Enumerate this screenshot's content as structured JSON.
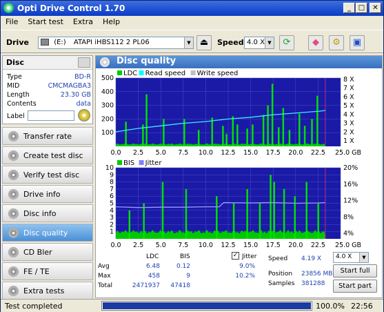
{
  "title": "Opti Drive Control 1.70",
  "menu": [
    "File",
    "Start test",
    "Extra",
    "Help"
  ],
  "toolbar": {
    "drive_label": "Drive",
    "drive_letter": "(E:)",
    "drive_name": "ATAPI  iHBS112   2 PL06",
    "speed_label": "Speed",
    "speed_value": "4.0 X"
  },
  "disc": {
    "header": "Disc",
    "rows": [
      {
        "k": "Type",
        "v": "BD-R"
      },
      {
        "k": "MID",
        "v": "CMCMAGBA3"
      },
      {
        "k": "Length",
        "v": "23.30 GB"
      },
      {
        "k": "Contents",
        "v": "data"
      }
    ],
    "label_key": "Label",
    "label_placeholder": ""
  },
  "nav": [
    "Transfer rate",
    "Create test disc",
    "Verify test disc",
    "Drive info",
    "Disc info",
    "Disc quality",
    "CD Bler",
    "FE / TE",
    "Extra tests"
  ],
  "nav_active": 5,
  "panel_title": "Disc quality",
  "chart_data": [
    {
      "type": "area",
      "legend": [
        "LDC",
        "Read speed",
        "Write speed"
      ],
      "legend_colors": [
        "#00cc00",
        "#00ffff",
        "#c0c0c0"
      ],
      "yticks_left": [
        "500",
        "400",
        "300",
        "200",
        "100"
      ],
      "yticks_right": [
        "8 X",
        "7 X",
        "6 X",
        "5 X",
        "4 X",
        "3 X",
        "2 X",
        "1 X"
      ],
      "xticks": [
        "0.0",
        "2.5",
        "5.0",
        "7.5",
        "10.0",
        "12.5",
        "15.0",
        "17.5",
        "20.0",
        "22.5",
        "25.0 GB"
      ],
      "ylim": [
        0,
        500
      ],
      "xlim": [
        0,
        25
      ],
      "read_speed": {
        "x": [
          0,
          2.5,
          5,
          7.5,
          10,
          12.5,
          15,
          17.5,
          20,
          22.5,
          23.3
        ],
        "y": [
          1.7,
          2.1,
          2.4,
          2.7,
          2.9,
          3.2,
          3.4,
          3.7,
          3.9,
          4.1,
          4.19
        ]
      },
      "spikes": {
        "x": [
          1.1,
          3.0,
          3.4,
          5.3,
          7.6,
          9.2,
          10.7,
          11.9,
          12.3,
          13.0,
          13.5,
          14.6,
          15.2,
          16.4,
          16.9,
          17.4,
          18.1,
          18.6,
          19.3,
          20.4,
          21.0,
          21.8,
          22.4
        ],
        "y": [
          180,
          160,
          380,
          200,
          200,
          120,
          210,
          150,
          90,
          220,
          160,
          130,
          160,
          230,
          300,
          458,
          140,
          280,
          120,
          240,
          150,
          200,
          370
        ]
      }
    },
    {
      "type": "area",
      "legend": [
        "BIS",
        "Jitter"
      ],
      "legend_colors": [
        "#00cc00",
        "#8080ff"
      ],
      "yticks_left": [
        "10",
        "9",
        "8",
        "7",
        "6",
        "5",
        "4",
        "3",
        "2",
        "1"
      ],
      "yticks_right": [
        "20%",
        "16%",
        "12%",
        "8%",
        "4%"
      ],
      "xticks": [
        "0.0",
        "2.5",
        "5.0",
        "7.5",
        "10.0",
        "12.5",
        "15.0",
        "17.5",
        "20.0",
        "22.5",
        "25.0 GB"
      ],
      "ylim": [
        0,
        10
      ],
      "xlim": [
        0,
        25
      ],
      "jitter": {
        "x": [
          0,
          2.5,
          5,
          7.5,
          10,
          11.5,
          12.0,
          15,
          17.5,
          20,
          22.5,
          23.3
        ],
        "y": [
          9.0,
          8.8,
          8.9,
          8.9,
          9.0,
          9.0,
          10.2,
          10.1,
          10.2,
          10.0,
          10.1,
          10.2
        ]
      },
      "spikes": {
        "x": [
          1.5,
          3.1,
          5.2,
          7.8,
          11.2,
          13.1,
          14.6,
          16.0,
          17.2,
          17.6,
          18.7,
          19.9,
          21.2,
          22.5
        ],
        "y": [
          4,
          5,
          8,
          7,
          6,
          5,
          7,
          5,
          9,
          8,
          7,
          6,
          8,
          5
        ]
      }
    }
  ],
  "stats": {
    "col_ldc": "LDC",
    "col_bis": "BIS",
    "jitter_label": "Jitter",
    "rows": [
      {
        "label": "Avg",
        "ldc": "6.48",
        "bis": "0.12",
        "jitter": "9.0%"
      },
      {
        "label": "Max",
        "ldc": "458",
        "bis": "9",
        "jitter": "10.2%"
      },
      {
        "label": "Total",
        "ldc": "2471937",
        "bis": "47418",
        "jitter": ""
      }
    ],
    "speed_label": "Speed",
    "speed_value": "4.19 X",
    "speed_select": "4.0 X",
    "position_label": "Position",
    "position_value": "23856 MB",
    "samples_label": "Samples",
    "samples_value": "381288",
    "start_full": "Start full",
    "start_part": "Start part"
  },
  "status": {
    "text": "Test completed",
    "progress_text": "100.0%",
    "progress": 1.0,
    "time": "22:56"
  }
}
